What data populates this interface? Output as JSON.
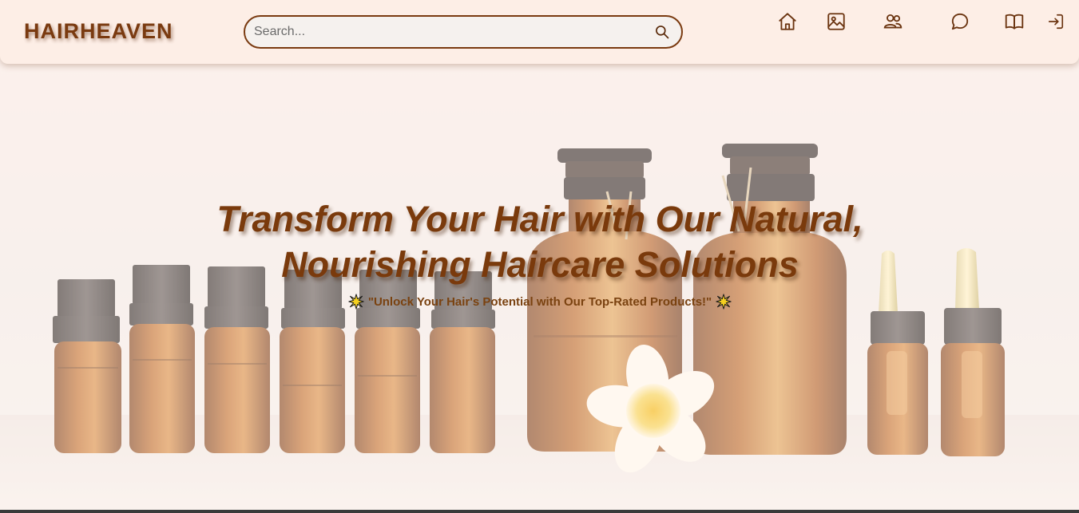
{
  "header": {
    "brand": "HAIRHEAVEN",
    "search": {
      "placeholder": "Search...",
      "value": ""
    },
    "nav": [
      {
        "id": "home",
        "icon": "home-icon"
      },
      {
        "id": "gallery",
        "icon": "image-icon"
      },
      {
        "id": "community",
        "icon": "users-icon"
      },
      {
        "id": "chat",
        "icon": "chat-bubble-icon"
      },
      {
        "id": "guides",
        "icon": "open-book-icon"
      },
      {
        "id": "login",
        "icon": "sign-in-icon"
      }
    ]
  },
  "hero": {
    "title_line1": "Transform Your Hair with Our Natural,",
    "title_line2": "Nourishing Haircare Solutions",
    "tagline": "\"Unlock Your Hair's Potential with Our Top-Rated Products!\"",
    "tagline_icon": "sparkle-burst-icon"
  },
  "colors": {
    "brand": "#7a3a10",
    "header_bg": "#fdeee6",
    "title": "#7a3a0c",
    "bottle_amber": "#a4561a"
  }
}
